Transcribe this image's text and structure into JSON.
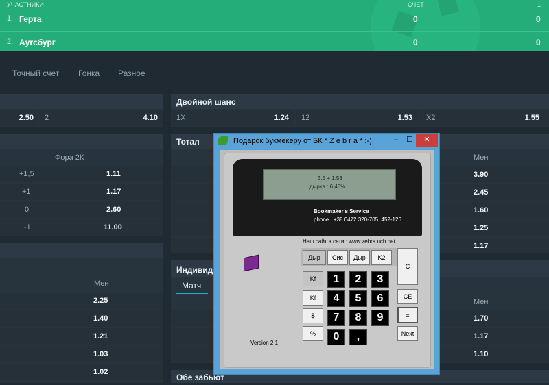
{
  "header": {
    "participants_label": "УЧАСТНИКИ",
    "score_label": "СЧЕТ",
    "period_label": "1",
    "teams": [
      {
        "num": "1.",
        "name": "Герта",
        "score": "0",
        "period": "0"
      },
      {
        "num": "2.",
        "name": "Аугсбург",
        "score": "0",
        "period": "0"
      }
    ]
  },
  "tabs": [
    "Точный счет",
    "Гонка",
    "Разное"
  ],
  "top_left_row": {
    "v1": "2.50",
    "label": "2",
    "v2": "4.10"
  },
  "double_chance": {
    "title": "Двойной шанс",
    "items": [
      {
        "label": "1X",
        "value": "1.24"
      },
      {
        "label": "12",
        "value": "1.53"
      },
      {
        "label": "X2",
        "value": "1.55"
      }
    ]
  },
  "handicap": {
    "col_header": "Фора 2К",
    "rows": [
      {
        "label": "+1,5",
        "value": "1.11"
      },
      {
        "label": "+1",
        "value": "1.17"
      },
      {
        "label": "0",
        "value": "2.60"
      },
      {
        "label": "-1",
        "value": "11.00"
      }
    ]
  },
  "total": {
    "title": "Тотал",
    "col_header": "Мен",
    "values": [
      "3.90",
      "2.45",
      "1.60",
      "1.25",
      "1.17"
    ]
  },
  "left_lower": {
    "col_header": "Мен",
    "values": [
      "2.25",
      "1.40",
      "1.21",
      "1.03",
      "1.02"
    ]
  },
  "individual": {
    "title": "Индивиду",
    "tab": "Матч",
    "col_header": "Мен",
    "values": [
      "1.70",
      "1.17",
      "1.10"
    ]
  },
  "both_score": {
    "title": "Обе забьют"
  },
  "window": {
    "title": "Подарок букмекеру от БК * Z e b r a * :-)",
    "minimize": "–",
    "maximize": "☐",
    "close": "✕",
    "lcd_line1": "3.5 + 1.53",
    "lcd_line2": "дырка :   6.46%",
    "service": "Bookmaker's Service",
    "phone": "phone : +38 0472 320-705, 452-126",
    "site": "Наш сайт в сети : www.zebra.uch.net",
    "mode_buttons": [
      "Дыр",
      "Сис",
      "Дыр",
      "K2"
    ],
    "side_buttons": [
      "Kf",
      "Kf",
      "$",
      "%"
    ],
    "num_buttons": [
      "1",
      "2",
      "3",
      "4",
      "5",
      "6",
      "7",
      "8",
      "9",
      "0",
      ","
    ],
    "right_buttons": [
      "C",
      "CE",
      "=",
      "Next"
    ],
    "version": "Version 2.1"
  }
}
